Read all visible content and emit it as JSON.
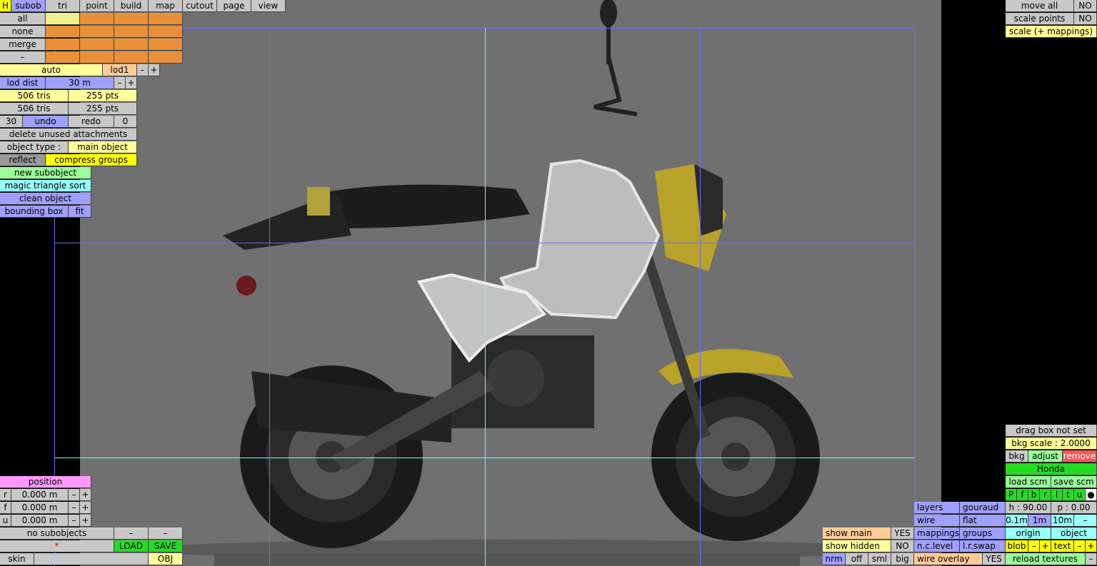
{
  "menu": {
    "tabs": [
      "H",
      "subob",
      "tri",
      "point",
      "build",
      "map",
      "cutout",
      "page",
      "view"
    ],
    "selection": [
      "all",
      "none",
      "merge",
      "–"
    ]
  },
  "lod": {
    "auto": "auto",
    "current": "lod1",
    "minus": "–",
    "plus": "+",
    "dist_label": "lod dist",
    "dist_value": "30 m"
  },
  "stats": [
    {
      "tris": "506 tris",
      "pts": "255 pts"
    },
    {
      "tris": "506 tris",
      "pts": "255 pts"
    }
  ],
  "history": {
    "count": "30",
    "undo": "undo",
    "redo": "redo",
    "redo_count": "0"
  },
  "actions": {
    "delete_unused": "delete unused attachments",
    "object_type_label": "object type :",
    "object_type_value": "main object",
    "reflect": "reflect",
    "compress": "compress groups",
    "new_subobject": "new subobject",
    "magic_sort": "magic triangle sort",
    "clean_object": "clean object",
    "bounding_box": "bounding box",
    "fit": "fit"
  },
  "position": {
    "title": "position",
    "rows": [
      {
        "axis": "r",
        "value": "0.000 m"
      },
      {
        "axis": "f",
        "value": "0.000 m"
      },
      {
        "axis": "u",
        "value": "0.000 m"
      }
    ]
  },
  "bottom_left": {
    "no_subobjects": "no subobjects",
    "marker": "*",
    "load": "LOAD",
    "save": "SAVE",
    "skin": "skin",
    "obj": "OBJ"
  },
  "top_right": {
    "move_all": "move all",
    "move_all_val": "NO",
    "scale_points": "scale points",
    "scale_points_val": "NO",
    "scale_mappings": "scale (+ mappings)"
  },
  "bkg": {
    "drag_box": "drag box not set",
    "scale": "bkg scale : 2.0000",
    "bkg": "bkg",
    "adjust": "adjust",
    "remove": "remove",
    "name": "Honda",
    "load_scm": "load scm",
    "save_scm": "save scm",
    "views": [
      "P",
      "f",
      "b",
      "r",
      "l",
      "t",
      "u",
      "●"
    ],
    "h": "h : 90.00",
    "p": "p : 0.00",
    "steps": [
      "0.1m",
      "1m",
      "10m",
      "–"
    ],
    "origin": "origin",
    "object": "object",
    "blob": "blob",
    "text": "text",
    "reload": "reload textures"
  },
  "display": {
    "layers": "layers",
    "gouraud": "gouraud",
    "wire": "wire",
    "flat": "flat",
    "mappings": "mappings",
    "groups": "groups",
    "nc_level": "n.c.level",
    "lr_swap": "l.r.swap",
    "wire_overlay": "wire overlay",
    "wire_overlay_val": "YES",
    "show_main": "show main",
    "show_main_val": "YES",
    "show_hidden": "show hidden",
    "show_hidden_val": "NO",
    "sizes": [
      "nrm",
      "off",
      "sml",
      "big"
    ]
  },
  "colors": {
    "viewport_bg": "#707070",
    "guide_blue": "#6a6aff",
    "guide_cyan": "#66ffff",
    "accent_green": "#22dd22"
  }
}
